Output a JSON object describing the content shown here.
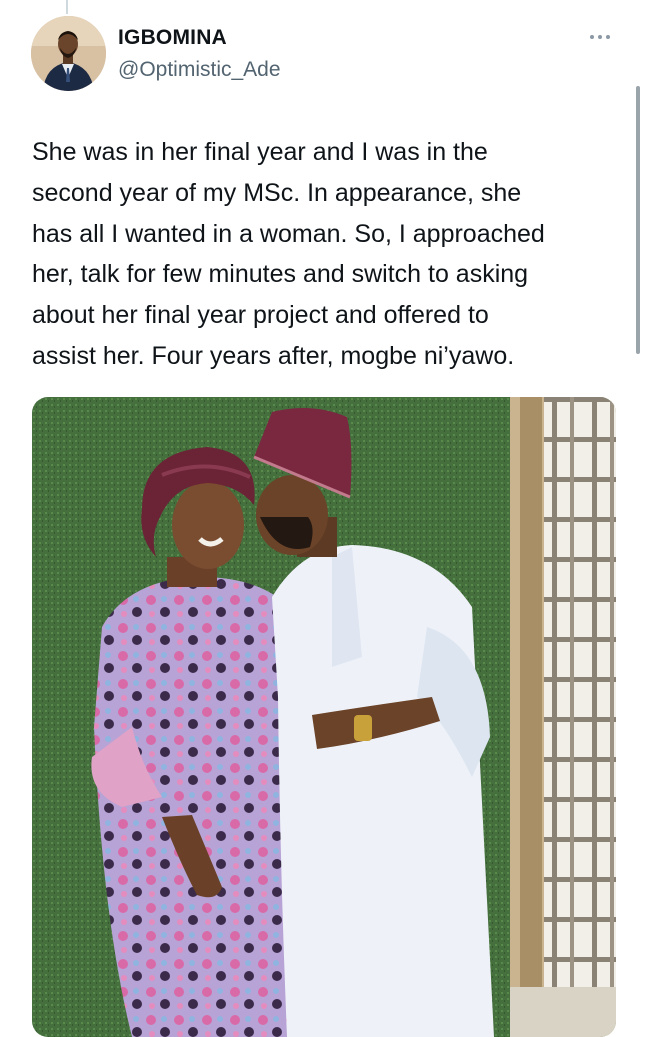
{
  "tweet": {
    "display_name": "IGBOMINA",
    "handle": "@Optimistic_Ade",
    "text": "She was in her final year and I was in the\nsecond year of my MSc. In appearance, she\nhas all I wanted in a woman. So, I approached\nher, talk for few minutes and switch to asking\nabout her final year project and offered to\nassist her. Four years after, mogbe ni’yawo.",
    "more_icon": "more-horizontal-icon"
  },
  "colors": {
    "text": "#0f1419",
    "secondary": "#536471",
    "grass_wall": "#3f6b3a",
    "gele": "#7a2840",
    "agbada": "#eef2f8"
  }
}
